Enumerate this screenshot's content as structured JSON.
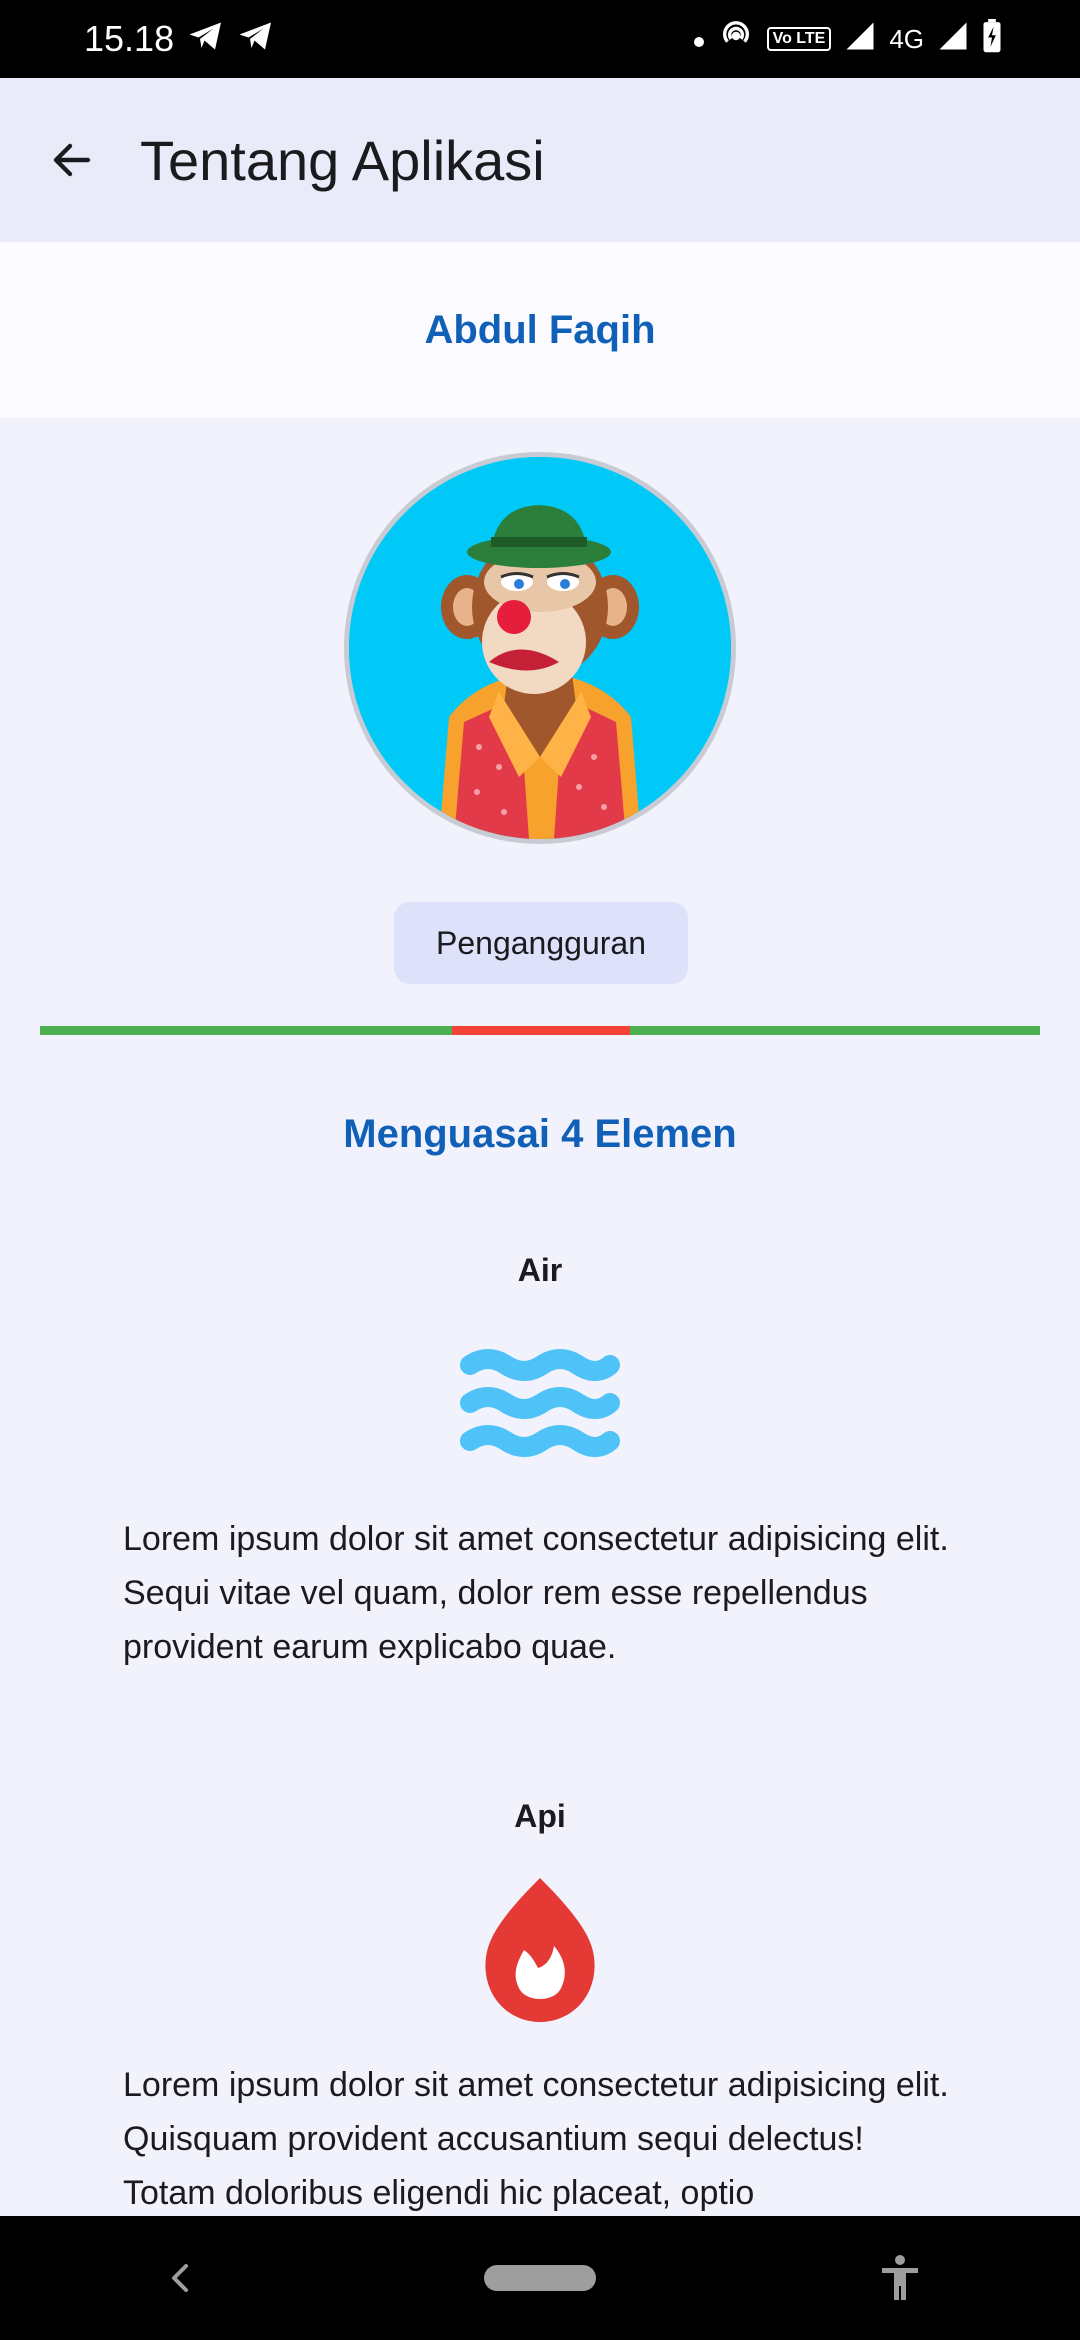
{
  "status_bar": {
    "time": "15.18",
    "network": "4G",
    "volte": "Vo LTE"
  },
  "app_bar": {
    "title": "Tentang Aplikasi"
  },
  "profile": {
    "name": "Abdul Faqih",
    "role": "Pengangguran"
  },
  "section": {
    "title": "Menguasai 4 Elemen"
  },
  "elements": [
    {
      "title": "Air",
      "icon": "water-waves-icon",
      "text": "Lorem ipsum dolor sit amet consectetur adipisicing elit. Sequi vitae vel quam, dolor rem esse repellendus provident earum explicabo quae."
    },
    {
      "title": "Api",
      "icon": "fire-icon",
      "text": "Lorem ipsum dolor sit amet consectetur adipisicing elit. Quisquam provident accusantium sequi delectus! Totam doloribus eligendi hic placeat, optio"
    }
  ],
  "colors": {
    "accent": "#1160b8",
    "divider_green": "#4caf50",
    "divider_red": "#f44336",
    "water": "#4fc3f7",
    "fire": "#e53935"
  },
  "nav": {
    "back": "nav-back-icon",
    "home": "home-pill-icon",
    "accessibility": "accessibility-icon"
  }
}
